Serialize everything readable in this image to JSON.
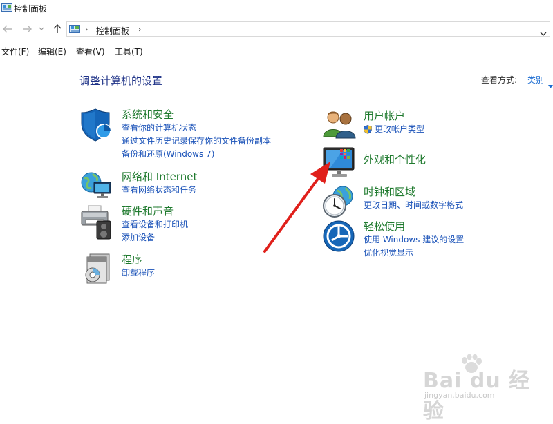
{
  "window": {
    "title": "控制面板"
  },
  "address": {
    "path": "控制面板",
    "separator": "›"
  },
  "menu": [
    "文件(F)",
    "编辑(E)",
    "查看(V)",
    "工具(T)"
  ],
  "header": {
    "title": "调整计算机的设置",
    "view_label": "查看方式:",
    "view_value": "类别"
  },
  "categories": {
    "system": {
      "title": "系统和安全",
      "links": [
        "查看你的计算机状态",
        "通过文件历史记录保存你的文件备份副本",
        "备份和还原(Windows 7)"
      ]
    },
    "network": {
      "title": "网络和 Internet",
      "links": [
        "查看网络状态和任务"
      ]
    },
    "hardware": {
      "title": "硬件和声音",
      "links": [
        "查看设备和打印机",
        "添加设备"
      ]
    },
    "programs": {
      "title": "程序",
      "links": [
        "卸载程序"
      ]
    },
    "user": {
      "title": "用户帐户",
      "links": [
        "更改帐户类型"
      ]
    },
    "appearance": {
      "title": "外观和个性化",
      "links": []
    },
    "clock": {
      "title": "时钟和区域",
      "links": [
        "更改日期、时间或数字格式"
      ]
    },
    "ease": {
      "title": "轻松使用",
      "links": [
        "使用 Windows 建议的设置",
        "优化视觉显示"
      ]
    }
  },
  "watermark": {
    "text": "Bai du 经验",
    "sub": "jingyan.baidu.com"
  },
  "colors": {
    "title_blue": "#1e3287",
    "category_green": "#1f7a2e",
    "link_blue": "#1a52b8",
    "annotation_red": "#e0201b"
  }
}
